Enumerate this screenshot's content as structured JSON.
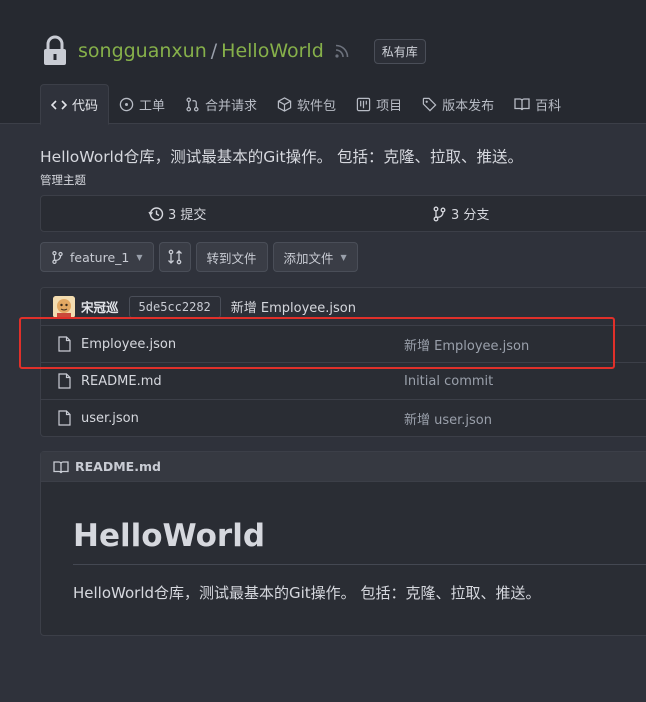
{
  "repo": {
    "owner": "songguanxun",
    "separator": "/",
    "name": "HelloWorld",
    "badge": "私有库"
  },
  "tabs": [
    {
      "label": "代码",
      "icon": "code-icon",
      "active": true
    },
    {
      "label": "工单",
      "icon": "issue-icon"
    },
    {
      "label": "合并请求",
      "icon": "pull-request-icon"
    },
    {
      "label": "软件包",
      "icon": "package-icon"
    },
    {
      "label": "项目",
      "icon": "project-icon"
    },
    {
      "label": "版本发布",
      "icon": "tag-icon"
    },
    {
      "label": "百科",
      "icon": "book-icon"
    }
  ],
  "description": "HelloWorld仓库，测试最基本的Git操作。 包括：克隆、拉取、推送。",
  "manage_topics": "管理主题",
  "stats": {
    "commits": "3 提交",
    "branches": "3 分支"
  },
  "toolbar": {
    "branch": "feature_1",
    "goto_file": "转到文件",
    "add_file": "添加文件"
  },
  "latest_commit": {
    "author": "宋冠巡",
    "sha": "5de5cc2282",
    "message": "新增 Employee.json"
  },
  "files": [
    {
      "name": "Employee.json",
      "commit": "新增 Employee.json"
    },
    {
      "name": "README.md",
      "commit": "Initial commit"
    },
    {
      "name": "user.json",
      "commit": "新增 user.json"
    }
  ],
  "readme": {
    "filename": "README.md",
    "heading": "HelloWorld",
    "body": "HelloWorld仓库，测试最基本的Git操作。 包括：克隆、拉取、推送。"
  },
  "colors": {
    "accent": "#86b04a",
    "highlight": "#e0302a",
    "background": "#2f323b"
  }
}
